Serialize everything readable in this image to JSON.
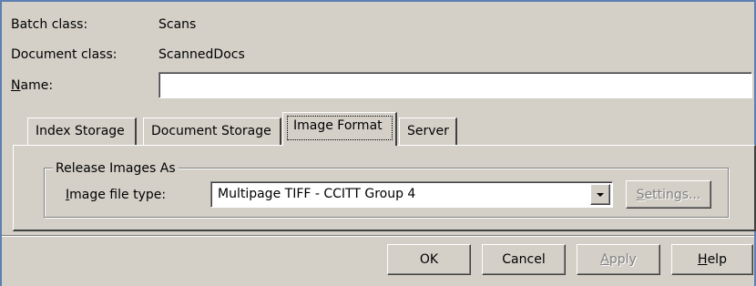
{
  "fields": {
    "batch_class_label": "Batch class:",
    "batch_class_value": "Scans",
    "document_class_label": "Document class:",
    "document_class_value": "ScannedDocs",
    "name_label_first": "N",
    "name_label_rest": "ame:",
    "name_value": ""
  },
  "tabs": [
    {
      "label": "Index Storage"
    },
    {
      "label": "Document Storage"
    },
    {
      "label": "Image Format"
    },
    {
      "label": "Server"
    }
  ],
  "image_format": {
    "group_title": "Release Images As",
    "image_file_type_label_first": "I",
    "image_file_type_label_rest": "mage file type:",
    "image_file_type_value": "Multipage TIFF - CCITT Group 4",
    "settings_first": "S",
    "settings_rest": "ettings..."
  },
  "buttons": {
    "ok": "OK",
    "cancel": "Cancel",
    "apply_first": "A",
    "apply_rest": "pply",
    "help_first": "H",
    "help_rest": "elp"
  },
  "colors": {
    "dialog_background": "#d4d0c8",
    "window_frame": "#5d7fb2",
    "disabled_text": "#808080"
  },
  "icons": {
    "dropdown": "chevron-down-icon"
  }
}
